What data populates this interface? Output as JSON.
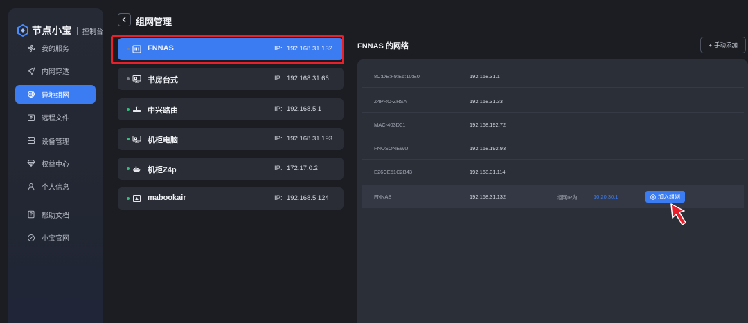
{
  "brand": {
    "name": "节点小宝",
    "sub": "控制台",
    "accent": "#3b7cf3"
  },
  "sidebar": {
    "items": [
      {
        "label": "我的服务",
        "icon": "fan-icon"
      },
      {
        "label": "内网穿透",
        "icon": "send-icon"
      },
      {
        "label": "异地组网",
        "icon": "globe-icon",
        "active": true
      },
      {
        "label": "远程文件",
        "icon": "upload-box-icon"
      },
      {
        "label": "设备管理",
        "icon": "server-icon"
      },
      {
        "label": "权益中心",
        "icon": "diamond-icon"
      },
      {
        "label": "个人信息",
        "icon": "user-icon"
      },
      {
        "label": "帮助文档",
        "icon": "help-doc-icon"
      },
      {
        "label": "小宝官网",
        "icon": "browser-icon"
      }
    ]
  },
  "header": {
    "title": "组网管理"
  },
  "devices": [
    {
      "name": "FNNAS",
      "ip_label": "IP:",
      "ip": "192.168.31.132",
      "status": "offline",
      "icon": "nas-icon",
      "selected": true
    },
    {
      "name": "书房台式",
      "ip_label": "IP:",
      "ip": "192.168.31.66",
      "status": "offline",
      "icon": "desktop-icon"
    },
    {
      "name": "中兴路由",
      "ip_label": "IP:",
      "ip": "192.168.5.1",
      "status": "online",
      "icon": "router-icon"
    },
    {
      "name": "机柜电脑",
      "ip_label": "IP:",
      "ip": "192.168.31.193",
      "status": "online",
      "icon": "desktop-icon"
    },
    {
      "name": "机柜Z4p",
      "ip_label": "IP:",
      "ip": "172.17.0.2",
      "status": "online",
      "icon": "docker-icon"
    },
    {
      "name": "mabookair",
      "ip_label": "IP:",
      "ip": "192.168.5.124",
      "status": "online",
      "icon": "laptop-icon"
    }
  ],
  "network": {
    "title": "FNNAS 的网络",
    "manual_add_label": "手动添加",
    "rows": [
      {
        "name": "8C:DE:F9:E6:10:E0",
        "ip": "192.168.31.1"
      },
      {
        "name": "Z4PRO-ZRSA",
        "ip": "192.168.31.33"
      },
      {
        "name": "MAC-403D01",
        "ip": "192.168.192.72"
      },
      {
        "name": "FNOSONEWU",
        "ip": "192.168.192.93"
      },
      {
        "name": "E26CE51C2B43",
        "ip": "192.168.31.114"
      },
      {
        "name": "FNNAS",
        "ip": "192.168.31.132",
        "vip_label": "组网IP为",
        "vip": "10.20.30.1",
        "join_label": "加入组网",
        "active": true
      }
    ]
  },
  "colors": {
    "online": "#2ec27e",
    "offline": "#7b808b",
    "highlight": "#e8202b"
  }
}
